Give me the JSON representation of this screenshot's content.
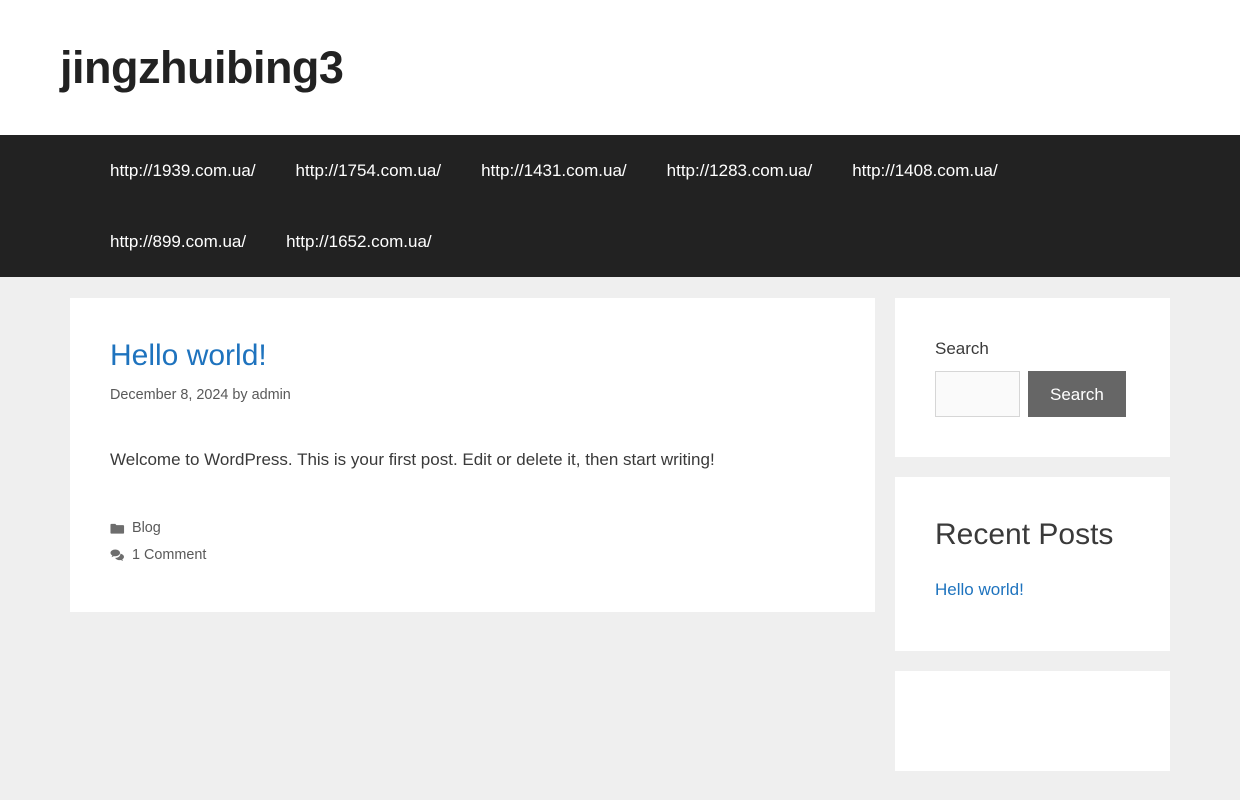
{
  "header": {
    "site_title": "jingzhuibing3"
  },
  "nav": {
    "items": [
      {
        "label": "http://1939.com.ua/"
      },
      {
        "label": "http://1754.com.ua/"
      },
      {
        "label": "http://1431.com.ua/"
      },
      {
        "label": "http://1283.com.ua/"
      },
      {
        "label": "http://1408.com.ua/"
      },
      {
        "label": "http://899.com.ua/"
      },
      {
        "label": "http://1652.com.ua/"
      }
    ]
  },
  "post": {
    "title": "Hello world!",
    "date": "December 8, 2024",
    "by_text": "by",
    "author": "admin",
    "content": "Welcome to WordPress. This is your first post. Edit or delete it, then start writing!",
    "category_icon": "folder-icon",
    "category": "Blog",
    "comments_icon": "comments-icon",
    "comments": "1 Comment"
  },
  "sidebar": {
    "search": {
      "label": "Search",
      "value": "",
      "placeholder": "",
      "button_label": "Search"
    },
    "recent_posts": {
      "title": "Recent Posts",
      "items": [
        {
          "label": "Hello world!"
        }
      ]
    }
  },
  "colors": {
    "link": "#1e73be",
    "nav_background": "#222222",
    "page_background": "#efefef",
    "button": "#666666",
    "text": "#3a3a3a",
    "meta_text": "#595959"
  }
}
